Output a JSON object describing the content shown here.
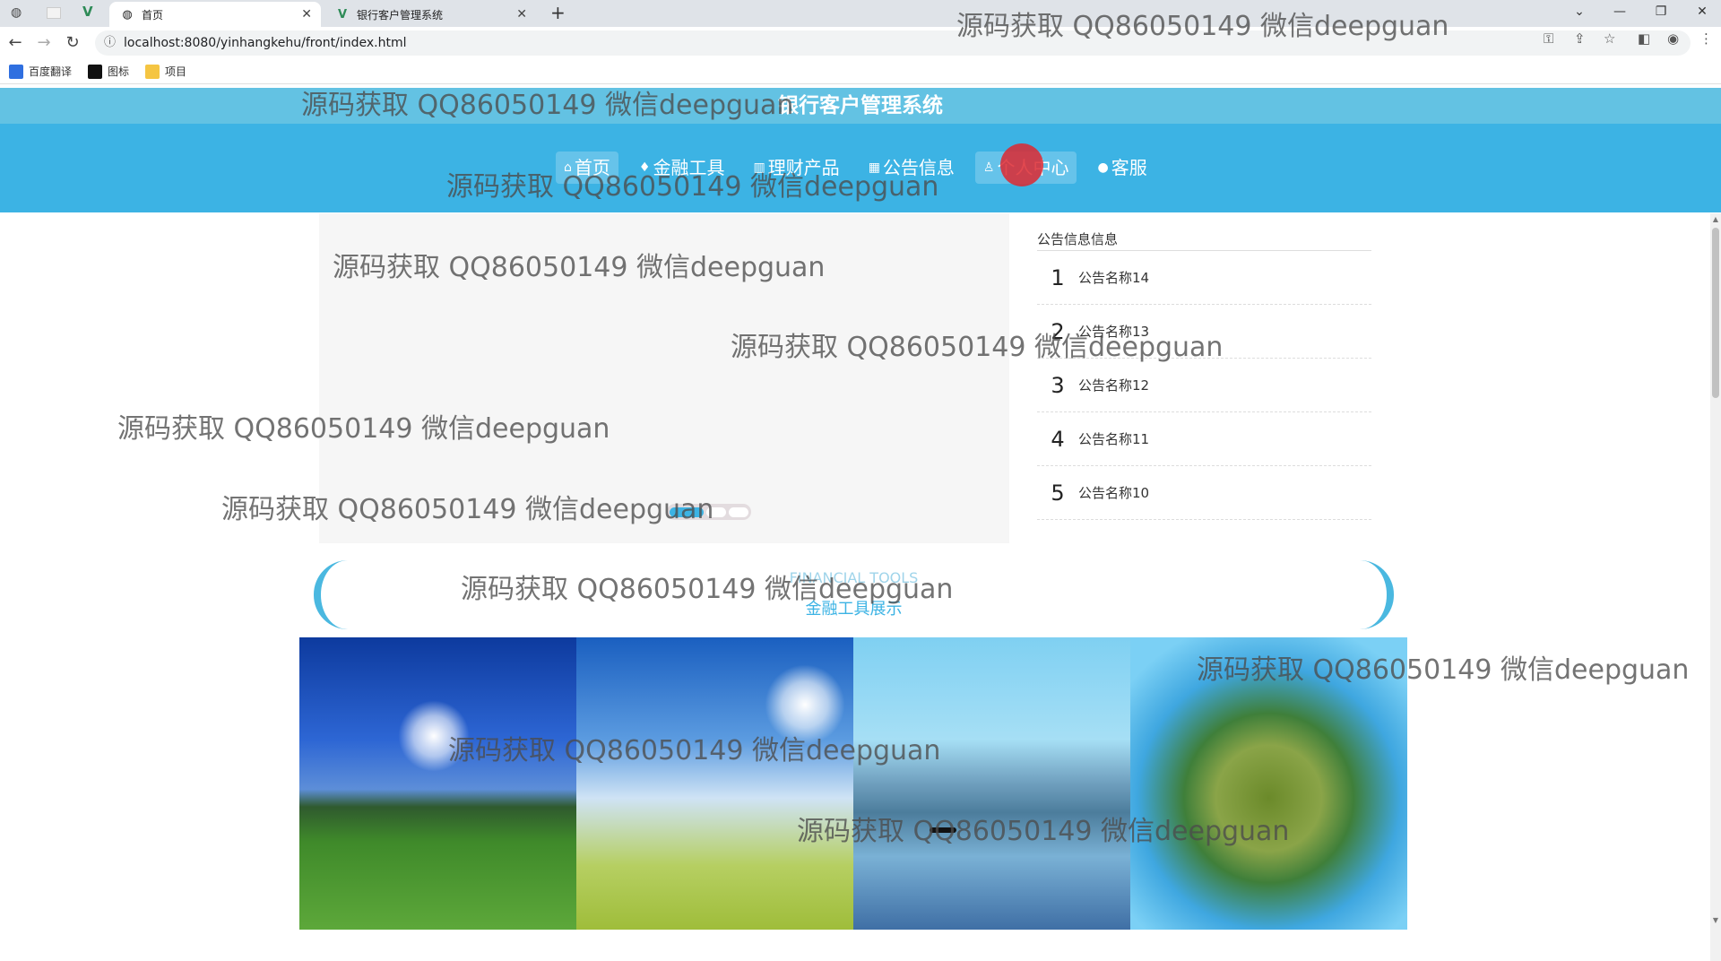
{
  "browser": {
    "tabs": [
      {
        "title": "首页",
        "active": true
      },
      {
        "title": "银行客户管理系统",
        "active": false
      }
    ],
    "new_tab_label": "+",
    "url": "localhost:8080/yinhangkehu/front/index.html",
    "bookmarks": [
      {
        "label": "百度翻译",
        "color": "#2f6fe0"
      },
      {
        "label": "图标",
        "color": "#111111"
      },
      {
        "label": "项目",
        "color": "#f5c542"
      }
    ]
  },
  "site": {
    "title": "银行客户管理系统",
    "menu": [
      {
        "icon": "home-icon",
        "glyph": "⌂",
        "label": "首页",
        "highlight": true
      },
      {
        "icon": "graduation-cap-icon",
        "glyph": "♦",
        "label": "金融工具",
        "highlight": false
      },
      {
        "icon": "chart-icon",
        "glyph": "▥",
        "label": "理财产品",
        "highlight": false
      },
      {
        "icon": "grid-icon",
        "glyph": "▦",
        "label": "公告信息",
        "highlight": false
      },
      {
        "icon": "user-icon",
        "glyph": "♙",
        "label": "个人中心",
        "highlight": true
      },
      {
        "icon": "service-icon",
        "glyph": "●",
        "label": "客服",
        "highlight": false
      }
    ],
    "carousel": {
      "dot_count": 3,
      "active_index": 0
    },
    "notices": {
      "heading": "公告信息信息",
      "items": [
        {
          "num": "1",
          "title": "公告名称14"
        },
        {
          "num": "2",
          "title": "公告名称13"
        },
        {
          "num": "3",
          "title": "公告名称12"
        },
        {
          "num": "4",
          "title": "公告名称11"
        },
        {
          "num": "5",
          "title": "公告名称10"
        }
      ]
    },
    "section": {
      "subtitle": "FINANCIAL TOOLS",
      "title": "金融工具展示"
    }
  },
  "watermark": "源码获取 QQ86050149 微信deepguan",
  "colors": {
    "header_light": "#63c2e3",
    "header": "#3cb3e4",
    "accent": "#3cb3e4"
  }
}
